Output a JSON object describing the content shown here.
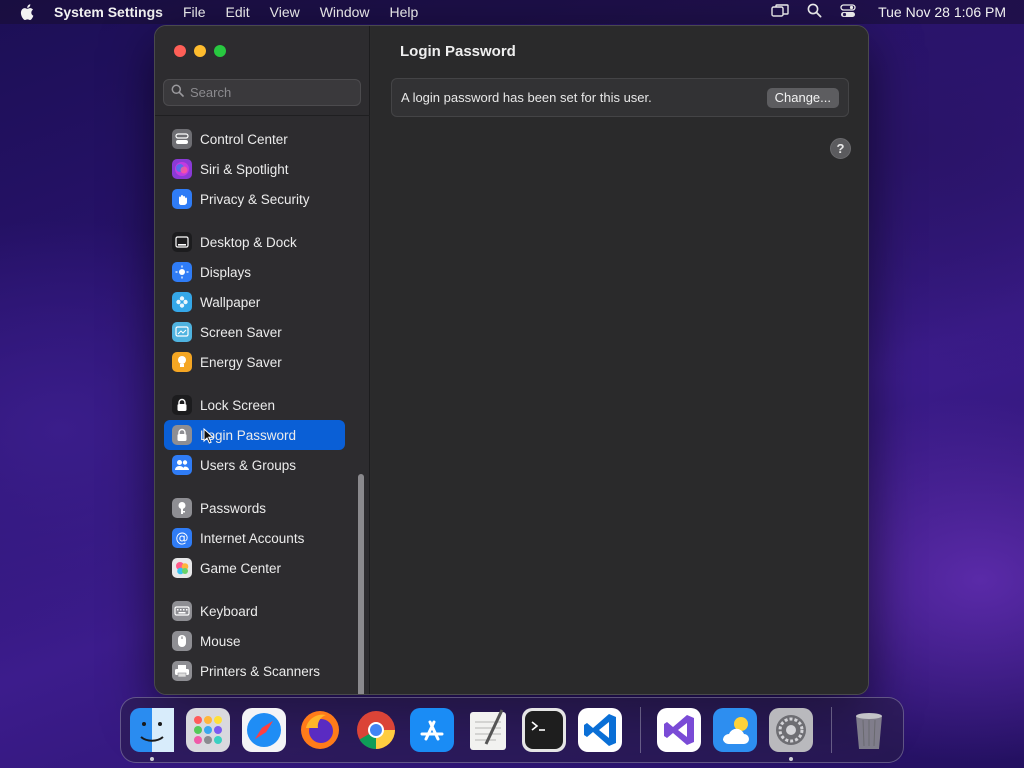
{
  "menubar": {
    "app_name": "System Settings",
    "menus": [
      "File",
      "Edit",
      "View",
      "Window",
      "Help"
    ],
    "clock": "Tue Nov 28  1:06 PM",
    "status_icons": [
      "screen-mirroring-icon",
      "spotlight-search-icon",
      "control-center-icon"
    ]
  },
  "sidebar": {
    "search_placeholder": "Search",
    "groups": [
      [
        {
          "label": "Control Center",
          "icon": "control-center-icon",
          "color": "#6e6e73"
        },
        {
          "label": "Siri & Spotlight",
          "icon": "siri-icon",
          "color": "#8a3ad6"
        },
        {
          "label": "Privacy & Security",
          "icon": "hand-icon",
          "color": "#2f7cf6"
        }
      ],
      [
        {
          "label": "Desktop & Dock",
          "icon": "dock-icon",
          "color": "#1c1c1e"
        },
        {
          "label": "Displays",
          "icon": "sun-icon",
          "color": "#2f7cf6"
        },
        {
          "label": "Wallpaper",
          "icon": "flower-icon",
          "color": "#35a7e8"
        },
        {
          "label": "Screen Saver",
          "icon": "screen-saver-icon",
          "color": "#4fb3e0"
        },
        {
          "label": "Energy Saver",
          "icon": "bulb-icon",
          "color": "#f5a623"
        }
      ],
      [
        {
          "label": "Lock Screen",
          "icon": "lock-icon",
          "color": "#1c1c1e"
        },
        {
          "label": "Login Password",
          "icon": "lock-icon",
          "color": "#8e8e93",
          "selected": true
        },
        {
          "label": "Users & Groups",
          "icon": "users-icon",
          "color": "#2f7cf6"
        }
      ],
      [
        {
          "label": "Passwords",
          "icon": "key-icon",
          "color": "#8e8e93"
        },
        {
          "label": "Internet Accounts",
          "icon": "at-icon",
          "color": "#2f7cf6"
        },
        {
          "label": "Game Center",
          "icon": "game-center-icon",
          "color": "#e8e8ea"
        }
      ],
      [
        {
          "label": "Keyboard",
          "icon": "keyboard-icon",
          "color": "#8e8e93"
        },
        {
          "label": "Mouse",
          "icon": "mouse-icon",
          "color": "#8e8e93"
        },
        {
          "label": "Printers & Scanners",
          "icon": "printer-icon",
          "color": "#8e8e93"
        }
      ]
    ]
  },
  "main": {
    "title": "Login Password",
    "status": "A login password has been set for this user.",
    "change_label": "Change...",
    "help_label": "?"
  },
  "dock": {
    "apps": [
      {
        "name": "finder",
        "color": "#2a8cf0",
        "running": true
      },
      {
        "name": "launchpad",
        "color": "#d9d9de",
        "running": false
      },
      {
        "name": "safari",
        "color": "#1f8df5",
        "running": false
      },
      {
        "name": "firefox",
        "color": "#5a2bc2",
        "running": false
      },
      {
        "name": "chrome",
        "color": "#ffffff",
        "running": false
      },
      {
        "name": "app-store",
        "color": "#1a8cf5",
        "running": false
      },
      {
        "name": "textedit",
        "color": "#f2f2f0",
        "running": false
      },
      {
        "name": "terminal",
        "color": "#1e1e1e",
        "running": false
      },
      {
        "name": "vscode",
        "color": "#ffffff",
        "running": false
      }
    ],
    "recent": [
      {
        "name": "visual-studio",
        "color": "#ffffff",
        "running": false
      },
      {
        "name": "weather",
        "color": "#2d8ef0",
        "running": false
      },
      {
        "name": "system-settings",
        "color": "#8e8e93",
        "running": true
      }
    ],
    "trash": {
      "name": "trash",
      "color": "#9a9aa0"
    }
  }
}
